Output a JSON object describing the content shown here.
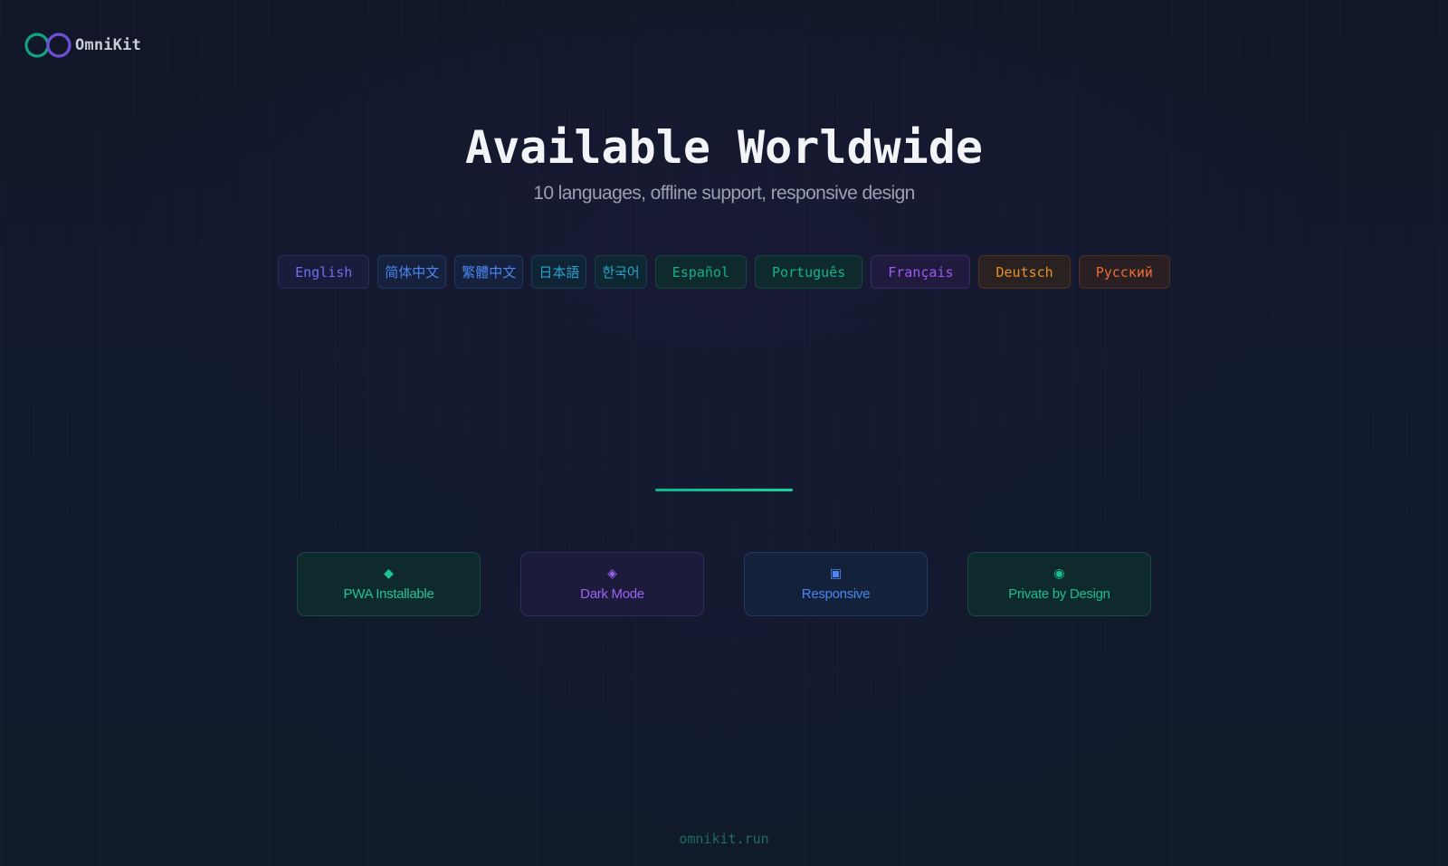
{
  "brand": {
    "name": "OmniKit",
    "logo_icon": "infinity-rings-icon",
    "colors": {
      "ring_left": "#10a37f",
      "ring_right": "#6d4fd8"
    }
  },
  "hero": {
    "title": "Available Worldwide",
    "subtitle": "10 languages, offline support, responsive design"
  },
  "languages": [
    {
      "label": "English",
      "color": "#6f6ff0",
      "bg": "#191c3a",
      "border": "#2a2e5a",
      "cjk": false
    },
    {
      "label": "简体中文",
      "color": "#4b86f0",
      "bg": "#15213d",
      "border": "#223765",
      "cjk": true
    },
    {
      "label": "繁體中文",
      "color": "#4b86f0",
      "bg": "#15213d",
      "border": "#223765",
      "cjk": true
    },
    {
      "label": "日本語",
      "color": "#2a9fcf",
      "bg": "#0f2535",
      "border": "#1a3d54",
      "cjk": true
    },
    {
      "label": "한국어",
      "color": "#22a8c6",
      "bg": "#0f2633",
      "border": "#173f50",
      "cjk": true
    },
    {
      "label": "Español",
      "color": "#15b08a",
      "bg": "#0f2a2c",
      "border": "#184541",
      "cjk": false
    },
    {
      "label": "Português",
      "color": "#14b38e",
      "bg": "#0f2a2c",
      "border": "#184541",
      "cjk": false
    },
    {
      "label": "Français",
      "color": "#9b5cf0",
      "bg": "#1f1a3e",
      "border": "#342a66",
      "cjk": false
    },
    {
      "label": "Deutsch",
      "color": "#e8902c",
      "bg": "#2a2220",
      "border": "#4d3420",
      "cjk": false
    },
    {
      "label": "Русский",
      "color": "#ee6c34",
      "bg": "#2a1f22",
      "border": "#4f2e24",
      "cjk": false
    }
  ],
  "features": [
    {
      "label": "PWA Installable",
      "icon": "◆",
      "icon_name": "diamond-icon",
      "color": "#1ec49a",
      "bg": "#0f2a2d",
      "border": "#1a4a44"
    },
    {
      "label": "Dark Mode",
      "icon": "◈",
      "icon_name": "diamond-outline-icon",
      "color": "#9b63f2",
      "bg": "#1c1b3c",
      "border": "#322c62"
    },
    {
      "label": "Responsive",
      "icon": "▣",
      "icon_name": "square-icon",
      "color": "#4b86f0",
      "bg": "#14213b",
      "border": "#223a66"
    },
    {
      "label": "Private by Design",
      "icon": "◉",
      "icon_name": "circle-target-icon",
      "color": "#17c08f",
      "bg": "#0f2a2d",
      "border": "#1a4a44"
    }
  ],
  "footer": {
    "url": "omnikit.run"
  }
}
